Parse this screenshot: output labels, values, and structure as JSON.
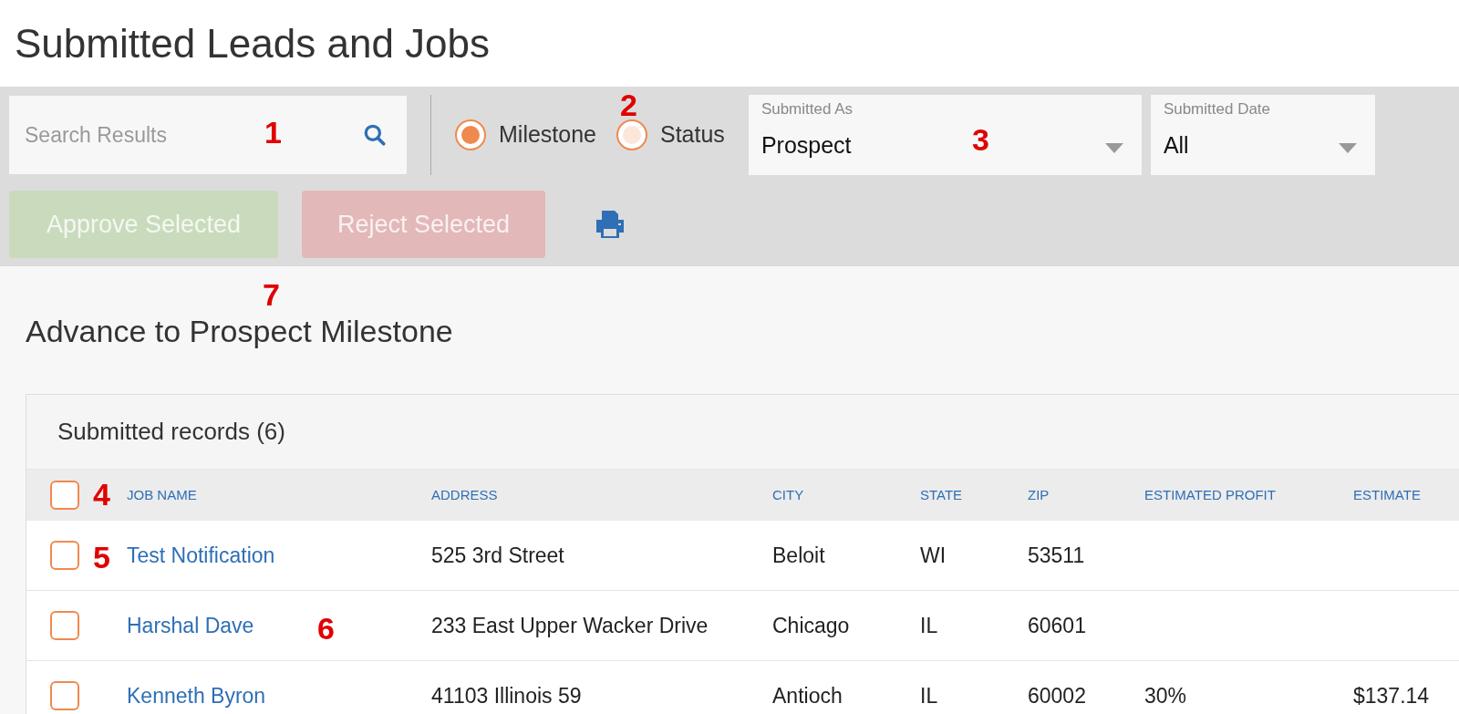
{
  "title": "Submitted Leads and Jobs",
  "search": {
    "placeholder": "Search Results"
  },
  "view_options": [
    {
      "label": "Milestone",
      "selected": true
    },
    {
      "label": "Status",
      "selected": false
    }
  ],
  "dropdowns": [
    {
      "label": "Submitted As",
      "value": "Prospect"
    },
    {
      "label": "Submitted Date",
      "value": "All"
    }
  ],
  "actions": [
    {
      "label": "Approve Selected",
      "kind": "approve",
      "disabled": true
    },
    {
      "label": "Reject Selected",
      "kind": "reject",
      "disabled": true
    }
  ],
  "section_title": "Advance to Prospect Milestone",
  "table": {
    "title": "Submitted records (6)",
    "all_checked": false,
    "columns": [
      "JOB NAME",
      "ADDRESS",
      "CITY",
      "STATE",
      "ZIP",
      "ESTIMATED PROFIT",
      "ESTIMATE"
    ],
    "rows": [
      {
        "checked": false,
        "cells": [
          "Test Notification",
          "525 3rd Street",
          "Beloit",
          "WI",
          "53511",
          "",
          ""
        ]
      },
      {
        "checked": false,
        "cells": [
          "Harshal Dave",
          "233 East Upper Wacker Drive",
          "Chicago",
          "IL",
          "60601",
          "",
          ""
        ]
      },
      {
        "checked": false,
        "cells": [
          "Kenneth Byron",
          "41103 Illinois 59",
          "Antioch",
          "IL",
          "60002",
          "30%",
          "$137.14"
        ]
      }
    ]
  },
  "annotations": [
    {
      "text": "1",
      "kind": "search"
    },
    {
      "text": "2",
      "kind": "radios"
    },
    {
      "text": "3",
      "kind": "dropdown"
    },
    {
      "text": "4",
      "kind": "headercheck"
    },
    {
      "text": "5",
      "kind": "rowcheck"
    },
    {
      "text": "6",
      "kind": "rowname"
    },
    {
      "text": "7",
      "kind": "buttons"
    }
  ]
}
